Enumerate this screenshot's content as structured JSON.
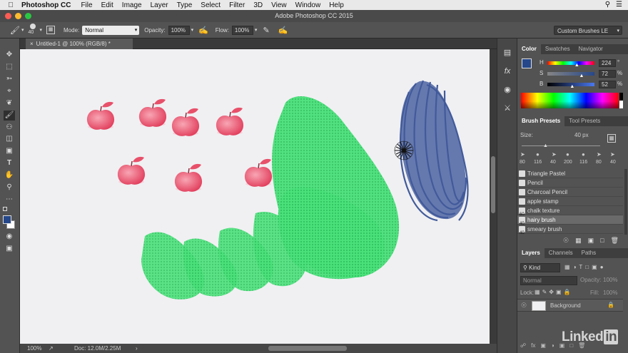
{
  "menubar": {
    "app_name": "Photoshop CC",
    "items": [
      "File",
      "Edit",
      "Image",
      "Layer",
      "Type",
      "Select",
      "Filter",
      "3D",
      "View",
      "Window",
      "Help"
    ]
  },
  "window": {
    "title": "Adobe Photoshop CC 2015"
  },
  "options": {
    "brush_size": "40",
    "mode_label": "Mode:",
    "mode_value": "Normal",
    "opacity_label": "Opacity:",
    "opacity_value": "100%",
    "flow_label": "Flow:",
    "flow_value": "100%",
    "workspace": "Custom Brushes LE"
  },
  "document": {
    "tab": "Untitled-1 @ 100% (RGB/8) *",
    "zoom": "100%",
    "doc_info": "Doc: 12.0M/2.25M"
  },
  "color_panel": {
    "tabs": [
      "Color",
      "Swatches",
      "Navigator"
    ],
    "h_label": "H",
    "h_value": "224",
    "h_unit": "°",
    "s_label": "S",
    "s_value": "72",
    "s_unit": "%",
    "b_label": "B",
    "b_value": "52",
    "b_unit": "%",
    "h_level": 0.62,
    "s_level": 0.72,
    "b_level": 0.52
  },
  "brush_panel": {
    "tabs": [
      "Brush Presets",
      "Tool Presets"
    ],
    "size_label": "Size:",
    "size_value": "40 px",
    "size_level": 0.3,
    "tip_sizes": [
      "80",
      "116",
      "40",
      "200",
      "116",
      "80",
      "40"
    ],
    "presets": [
      {
        "name": "Triangle Pastel",
        "size": ""
      },
      {
        "name": "Pencil",
        "size": ""
      },
      {
        "name": "Charcoal Pencil",
        "size": ""
      },
      {
        "name": "apple stamp",
        "size": ""
      },
      {
        "name": "chalk texture",
        "size": "60"
      },
      {
        "name": "hairy brush",
        "size": "40"
      },
      {
        "name": "smeary brush",
        "size": "40"
      }
    ]
  },
  "layers_panel": {
    "tabs": [
      "Layers",
      "Channels",
      "Paths"
    ],
    "kind": "Kind",
    "blend": "Normal",
    "opacity_label": "Opacity:",
    "opacity_value": "100%",
    "lock_label": "Lock:",
    "fill_label": "Fill:",
    "fill_value": "100%",
    "layer_name": "Background"
  },
  "watermark": {
    "text": "Linked",
    "in": "in"
  },
  "colors": {
    "foreground": "#26488a",
    "green": "#3ddc6e",
    "blue": "#2f4a92",
    "apple": "#e8506a"
  }
}
